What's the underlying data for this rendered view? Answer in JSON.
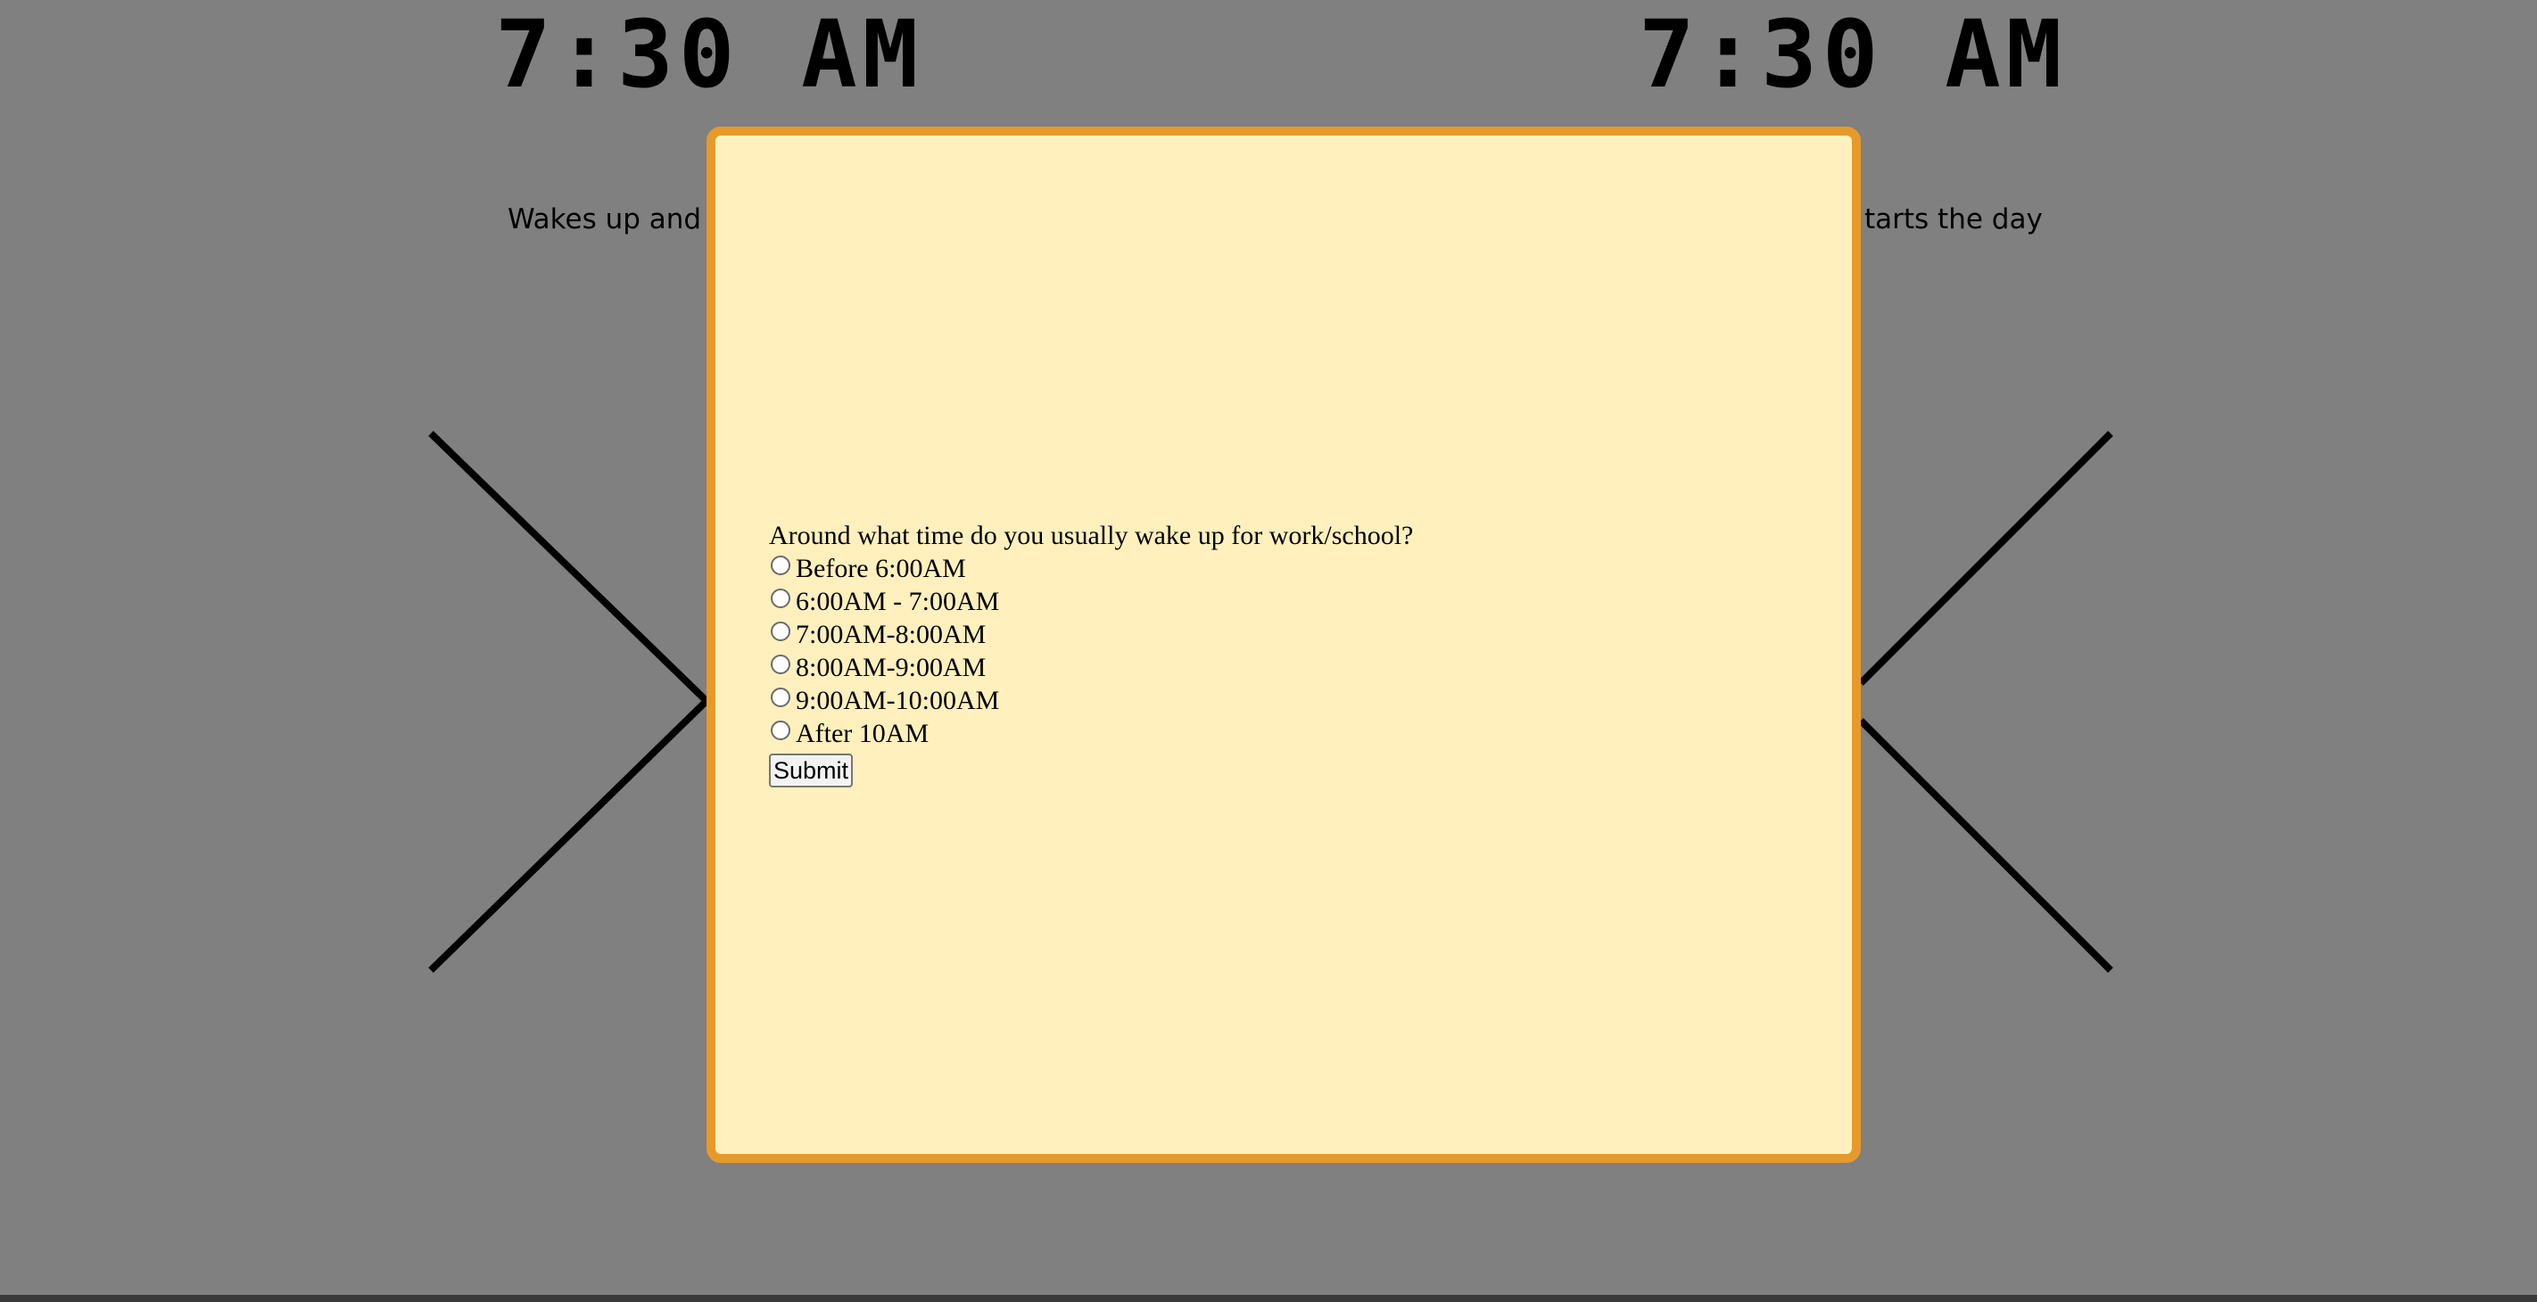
{
  "background": {
    "time_left": "7:30 AM",
    "time_right": "7:30 AM",
    "description_left": "Wakes up and s",
    "description_right": "tarts the day"
  },
  "modal": {
    "question": "Around what time do you usually wake up for work/school?",
    "options": [
      "Before 6:00AM",
      "6:00AM - 7:00AM",
      "7:00AM-8:00AM",
      "8:00AM-9:00AM",
      "9:00AM-10:00AM",
      "After 10AM"
    ],
    "submit_label": "Submit"
  },
  "colors": {
    "overlay": "#808080",
    "modal_background": "#fff0bd",
    "modal_border": "#e79a29"
  }
}
